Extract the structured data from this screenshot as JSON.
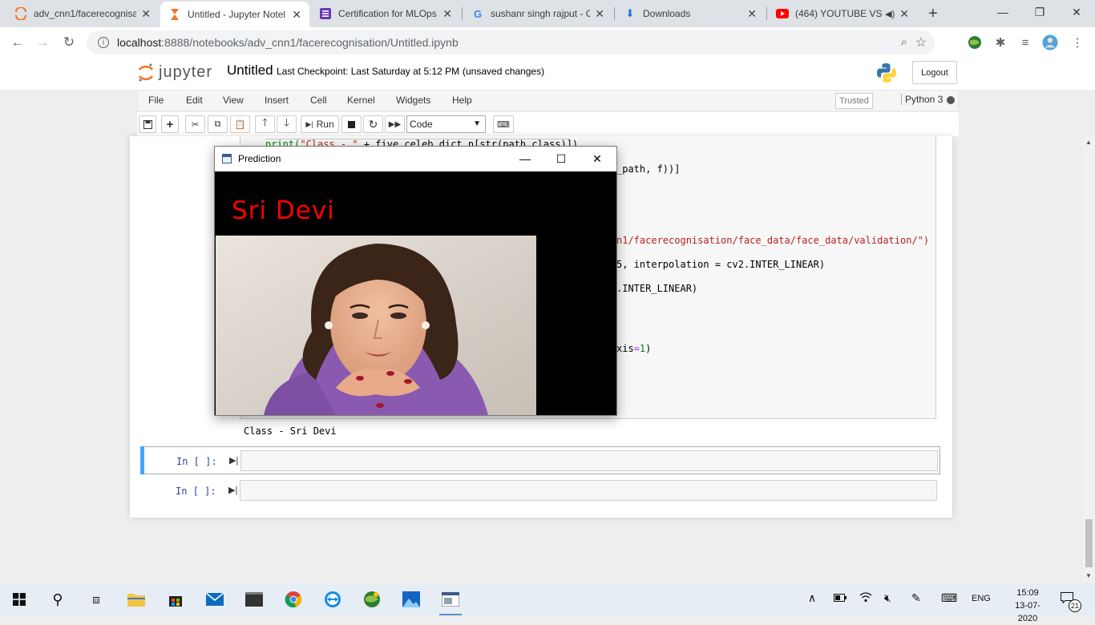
{
  "browser": {
    "tabs": [
      {
        "title": "adv_cnn1/facerecognisa",
        "icon": "jupyter-icon"
      },
      {
        "title": "Untitled - Jupyter Notel",
        "icon": "hourglass-icon"
      },
      {
        "title": "Certification for MLOps",
        "icon": "form-icon"
      },
      {
        "title": "sushanr singh rajput - G",
        "icon": "google-icon"
      },
      {
        "title": "Downloads",
        "icon": "download-icon"
      },
      {
        "title": "(464) YOUTUBE VS",
        "icon": "youtube-icon"
      }
    ],
    "new_tab": "+",
    "url_host": "localhost",
    "url_path": ":8888/notebooks/adv_cnn1/facerecognisation/Untitled.ipynb"
  },
  "jupyter": {
    "logo_text": "jupyter",
    "notebook_title": "Untitled",
    "checkpoint": "Last Checkpoint: Last Saturday at 5:12 PM",
    "status": "(unsaved changes)",
    "logout": "Logout",
    "menus": [
      "File",
      "Edit",
      "View",
      "Insert",
      "Cell",
      "Kernel",
      "Widgets",
      "Help"
    ],
    "trusted": "Trusted",
    "kernel": "Python 3",
    "toolbar": {
      "run_label": "Run",
      "cell_type": "Code"
    }
  },
  "code": {
    "line1_prefix": "print(",
    "line1_str": "\"Class - \"",
    "line1_rest": " + five_celeb_dict_n[str(path_class)])",
    "line2": "_path, f))]",
    "line3": "n1/facerecognisation/face_data/face_data/validation/\")",
    "line4": "5, interpolation = cv2.INTER_LINEAR)",
    "line5": ".INTER_LINEAR)",
    "line6_prefix": "xis",
    "line6_op": "=",
    "line6_num": "1",
    "line6_suffix": ")"
  },
  "output": {
    "text": "Class - Sri Devi"
  },
  "cells": [
    {
      "prompt": "In [ ]:"
    },
    {
      "prompt": "In [ ]:"
    }
  ],
  "prediction_window": {
    "title": "Prediction",
    "label": "Sri Devi",
    "label_color": "#ff0000"
  },
  "taskbar": {
    "lang": "ENG",
    "time": "15:09",
    "date": "13-07-2020",
    "notifications": "21"
  }
}
